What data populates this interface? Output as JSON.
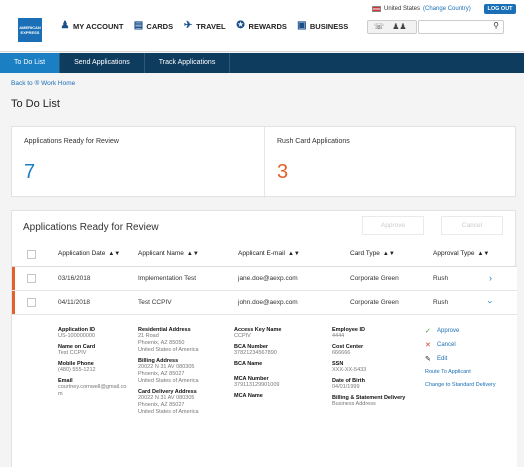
{
  "brand": {
    "logo_text": "AMERICAN EXPRESS",
    "accent": "#1b7fc4",
    "rush_color": "#e2612c",
    "nav_color": "#0d3c5f"
  },
  "topnav": [
    {
      "label": "MY ACCOUNT",
      "icon": "user-icon"
    },
    {
      "label": "CARDS",
      "icon": "card-icon"
    },
    {
      "label": "TRAVEL",
      "icon": "plane-icon"
    },
    {
      "label": "REWARDS",
      "icon": "rewards-icon"
    },
    {
      "label": "BUSINESS",
      "icon": "business-icon"
    }
  ],
  "utility": {
    "country": "United States",
    "change_country": "(Change Country)",
    "logout": "LOG OUT",
    "search_placeholder": ""
  },
  "subnav": [
    {
      "label": "To Do List",
      "active": true
    },
    {
      "label": "Send Applications",
      "active": false
    },
    {
      "label": "Track Applications",
      "active": false
    }
  ],
  "breadcrumb": "Back to ® Work Home",
  "page_title": "To Do List",
  "summary": {
    "ready": {
      "label": "Applications Ready for Review",
      "count": "7"
    },
    "rush": {
      "label": "Rush Card Applications",
      "count": "3"
    }
  },
  "panel": {
    "title": "Applications Ready for Review",
    "approve_label": "Approve",
    "cancel_label": "Cancel",
    "columns": [
      "Application Date",
      "Applicant Name",
      "Applicant E-mail",
      "Card Type",
      "Approval Type"
    ],
    "rows": [
      {
        "date": "03/16/2018",
        "name": "Implementation Test",
        "email": "jane.doe@aexp.com",
        "card_type": "Corporate Green",
        "approval": "Rush"
      },
      {
        "date": "04/11/2018",
        "name": "Test CCPIV",
        "email": "john.doe@aexp.com",
        "card_type": "Corporate Green",
        "approval": "Rush"
      }
    ]
  },
  "detail": {
    "application_id_label": "Application ID",
    "application_id": "US-100000000",
    "name_on_card_label": "Name on Card",
    "name_on_card": "Test CCPIV",
    "mobile_label": "Mobile Phone",
    "mobile": "(480) 555-1212",
    "email_label": "Email",
    "email": "courtney.cornwell@gmail.com",
    "residential_label": "Residential Address",
    "residential": [
      "21 Road",
      "Phoenix, AZ 85050",
      "United States of America"
    ],
    "billing_label": "Billing Address",
    "billing": [
      "20022 N 31 AV 080305",
      "Phoenix, AZ 85027",
      "United States of America"
    ],
    "delivery_label": "Card Delivery Address",
    "delivery": [
      "20022 N 31 AV 080305",
      "Phoenix, AZ 85027",
      "United States of America"
    ],
    "access_key_label": "Access Key Name",
    "access_key": "CCPIV",
    "bca_number_label": "BCA Number",
    "bca_number": "37821234567890",
    "bca_name_label": "BCA Name",
    "mca_number_label": "MCA Number",
    "mca_number": "379113129901009",
    "mca_name_label": "MCA Name",
    "employee_id_label": "Employee ID",
    "employee_id": "4444",
    "cost_center_label": "Cost Center",
    "cost_center": "666666",
    "ssn_label": "SSN",
    "ssn": "XXX-XX-5433",
    "dob_label": "Date of Birth",
    "dob": "04/01/1999",
    "billing_statement_label": "Billing & Statement Delivery",
    "billing_statement": "Business Address",
    "actions": {
      "approve": "Approve",
      "cancel": "Cancel",
      "edit": "Edit",
      "route": "Route To Applicant",
      "change": "Change to Standard Delivery"
    }
  }
}
